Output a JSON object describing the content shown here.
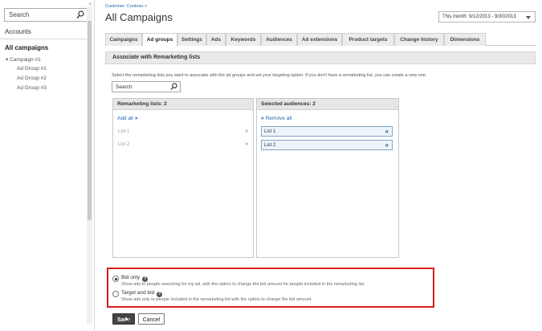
{
  "sidebar": {
    "search_placeholder": "Search",
    "accounts_label": "Accounts",
    "all_campaigns_label": "All campaigns",
    "campaign_label": "Campaign #1",
    "ad_groups": [
      "Ad Group #1",
      "Ad Group #2",
      "Ad Group #3"
    ]
  },
  "header": {
    "breadcrumb": "Customer: Contoso >",
    "title": "All Campaigns",
    "date_range": "This month: 9/12/2013 - 9/30/2013"
  },
  "tabs": [
    {
      "label": "Campaigns"
    },
    {
      "label": "Ad groups"
    },
    {
      "label": "Settings"
    },
    {
      "label": "Ads"
    },
    {
      "label": "Keywords"
    },
    {
      "label": "Audiences"
    },
    {
      "label": "Ad extensions"
    },
    {
      "label": "Product targets"
    },
    {
      "label": "Change history"
    },
    {
      "label": "Dimensions"
    }
  ],
  "active_tab": "Ad groups",
  "panel": {
    "title": "Associate with Remarketing lists",
    "instructions": "Select the remarketing lists you want to associate with the ad groups and set your targeting option. If you don't have a remarketing list, you can create a new one.",
    "search_placeholder": "Search"
  },
  "remarketing": {
    "header": "Remarketing lists: 2",
    "add_all_label": "Add all",
    "items": [
      "List 1",
      "List 2"
    ]
  },
  "selected": {
    "header": "Selected audiences: 2",
    "remove_all_label": "Remove all",
    "items": [
      "List 1",
      "List 2"
    ]
  },
  "targeting": {
    "bid_only_label": "Bid only",
    "bid_only_desc": "Show ads to people searching for my ad, with the option to change the bid amount for people included in the remarketing list.",
    "target_and_bid_label": "Target and bid",
    "target_and_bid_desc": "Show ads only to people included in the remarketing list with the option to change the bid amount.",
    "selected": "Bid only"
  },
  "buttons": {
    "save": "Save",
    "cancel": "Cancel"
  },
  "colors": {
    "link": "#2266aa",
    "highlight_border": "#d91c1c",
    "save_button": "#444444"
  }
}
